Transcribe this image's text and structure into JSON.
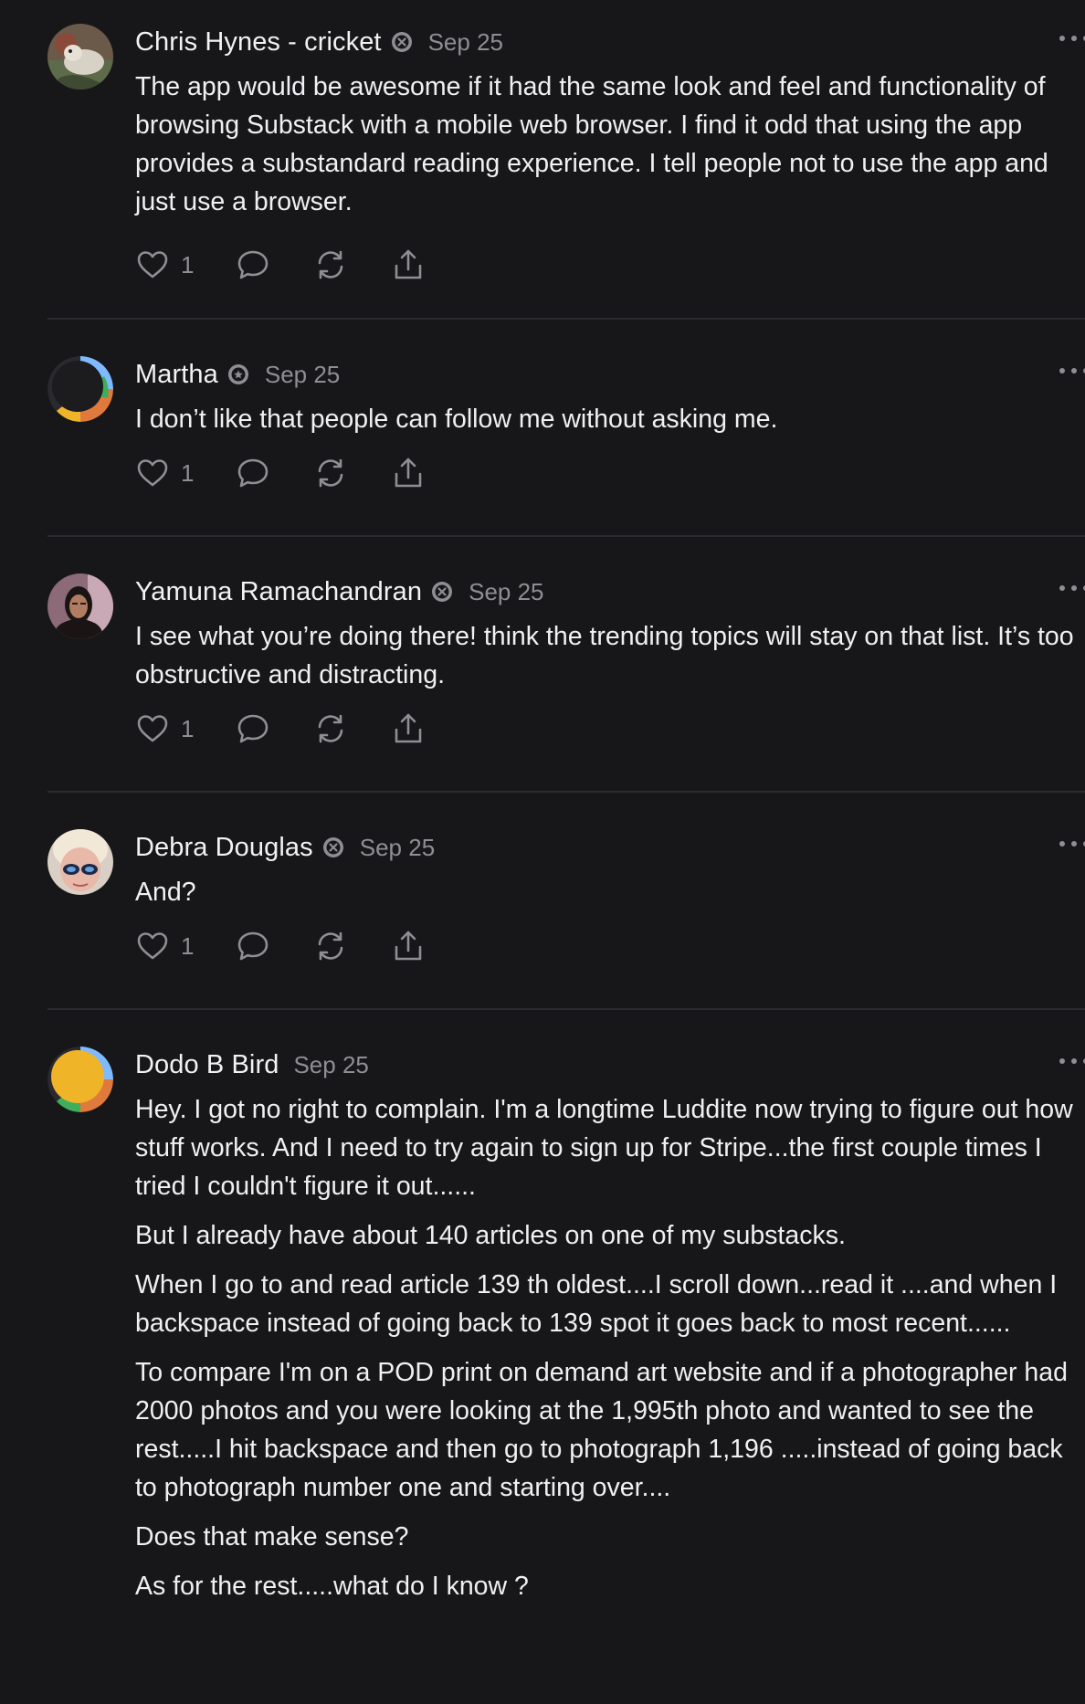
{
  "comments": [
    {
      "author": "Chris Hynes - cricket",
      "date": "Sep 25",
      "paragraphs": [
        "The app would be awesome if it had the same look and feel and functionality of browsing Substack with a mobile web browser. I find it odd that using the app provides a substandard reading experience. I tell people not to use the app and just use a browser."
      ],
      "likes": "1",
      "avatar_icon": "photo-avatar-bird"
    },
    {
      "author": "Martha",
      "date": "Sep 25",
      "paragraphs": [
        "I don’t like that people can follow me without asking me."
      ],
      "likes": "1",
      "avatar_icon": "default-avatar-dark"
    },
    {
      "author": "Yamuna Ramachandran",
      "date": "Sep 25",
      "paragraphs": [
        "I see what you’re doing there! think the trending topics will stay on that list. It’s too obstructive and distracting."
      ],
      "likes": "1",
      "avatar_icon": "photo-avatar-woman"
    },
    {
      "author": "Debra Douglas",
      "date": "Sep 25",
      "paragraphs": [
        "And?"
      ],
      "likes": "1",
      "avatar_icon": "photo-avatar-glasses"
    },
    {
      "author": "Dodo B Bird",
      "date": "Sep 25",
      "paragraphs": [
        "Hey. I got no right to complain. I'm a longtime Luddite now trying to figure out how stuff works. And I need to try again to sign up for Stripe...the first couple times I tried I couldn't figure it out......",
        "But I already have about 140 articles on one of my substacks.",
        "When I go to and read article 139 th oldest....I scroll down...read it ....and when I backspace instead of going back to 139 spot it goes back to most recent......",
        "To compare I'm on a POD print on demand art website and if a photographer had 2000 photos and you were looking at the 1,995th photo and wanted to see the rest.....I hit backspace and then go to photograph 1,196 .....instead of going back to photograph number one and starting over....",
        "Does that make sense?",
        "As for the rest.....what do I know ?"
      ],
      "avatar_icon": "default-avatar-yellow"
    }
  ],
  "colors": {
    "background": "#17171a",
    "text": "#f0f0f2",
    "muted": "#8e8e93",
    "divider": "#2c2c30"
  },
  "icons": {
    "badge": "subscriber-badge-icon",
    "like": "heart-icon",
    "reply": "comment-icon",
    "restack": "restack-icon",
    "share": "share-icon",
    "more": "more-options-icon"
  }
}
